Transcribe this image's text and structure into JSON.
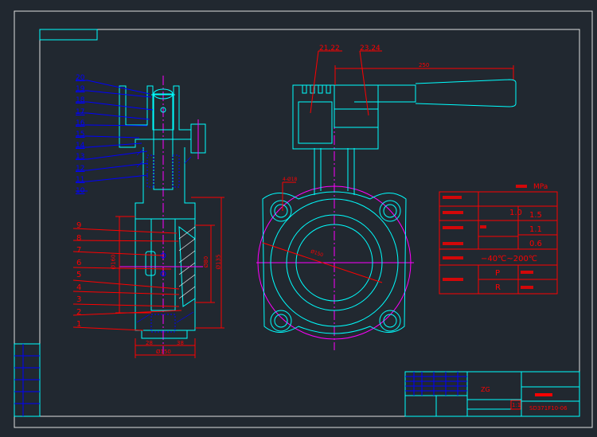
{
  "colors": {
    "background": "#212830",
    "outline": "#00ffff",
    "hatch": "#0000ff",
    "dimension": "#ff0000",
    "centerline": "#ff00ff",
    "frame": "#e0e0e0"
  },
  "left_view": {
    "upper_labels": [
      "20",
      "19",
      "18",
      "17",
      "16",
      "15",
      "14",
      "13",
      "12",
      "11",
      "10"
    ],
    "lower_labels": [
      "9",
      "8",
      "7",
      "6",
      "5",
      "4",
      "3",
      "2",
      "1"
    ],
    "dimensions": {
      "d_left": "Ø160",
      "d_seat": "Ø80",
      "d_right": "Ø135",
      "w_left": "28",
      "w_right": "38",
      "w_total": "Ø150"
    }
  },
  "right_view": {
    "callouts": [
      "21,22",
      "23,24"
    ],
    "dimensions": {
      "handle_length": "250",
      "bolt_holes": "4-Ø18",
      "bolt_circle": "Ø150"
    }
  },
  "spec_table": {
    "unit_label": "MPa",
    "rows": {
      "nominal_pressure": "1.0",
      "shell_test": "1.5",
      "seal_test_water": "1.1",
      "seal_test_air": "0.6",
      "temperature": "−40℃~200℃",
      "code_p": "P",
      "code_r": "R"
    }
  },
  "title_block": {
    "scale": "1:1",
    "drawing_number": "SD371F10-06",
    "company_mark": "ZG"
  }
}
